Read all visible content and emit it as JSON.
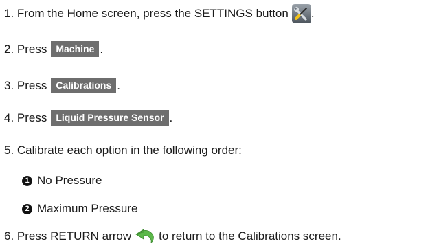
{
  "steps": [
    {
      "prefix": "1. From the Home screen, press the SETTINGS button",
      "suffix": ".",
      "icon": "settings-tools-icon"
    },
    {
      "prefix": "2. Press",
      "button": "Machine",
      "suffix": "."
    },
    {
      "prefix": "3. Press",
      "button": "Calibrations",
      "suffix": "."
    },
    {
      "prefix": "4. Press",
      "button": "Liquid Pressure Sensor",
      "suffix": "."
    },
    {
      "text": "5. Calibrate each option in the following order:"
    },
    {
      "prefix": "6. Press RETURN arrow",
      "suffix": "to return to the Calibrations screen.",
      "icon": "return-arrow-icon"
    }
  ],
  "options": [
    {
      "marker": "1",
      "label": "No Pressure"
    },
    {
      "marker": "2",
      "label": "Maximum Pressure"
    }
  ],
  "colors": {
    "button_bg": "#6e6e6e",
    "button_text": "#ffffff",
    "return_arrow": "#5cb84a"
  }
}
